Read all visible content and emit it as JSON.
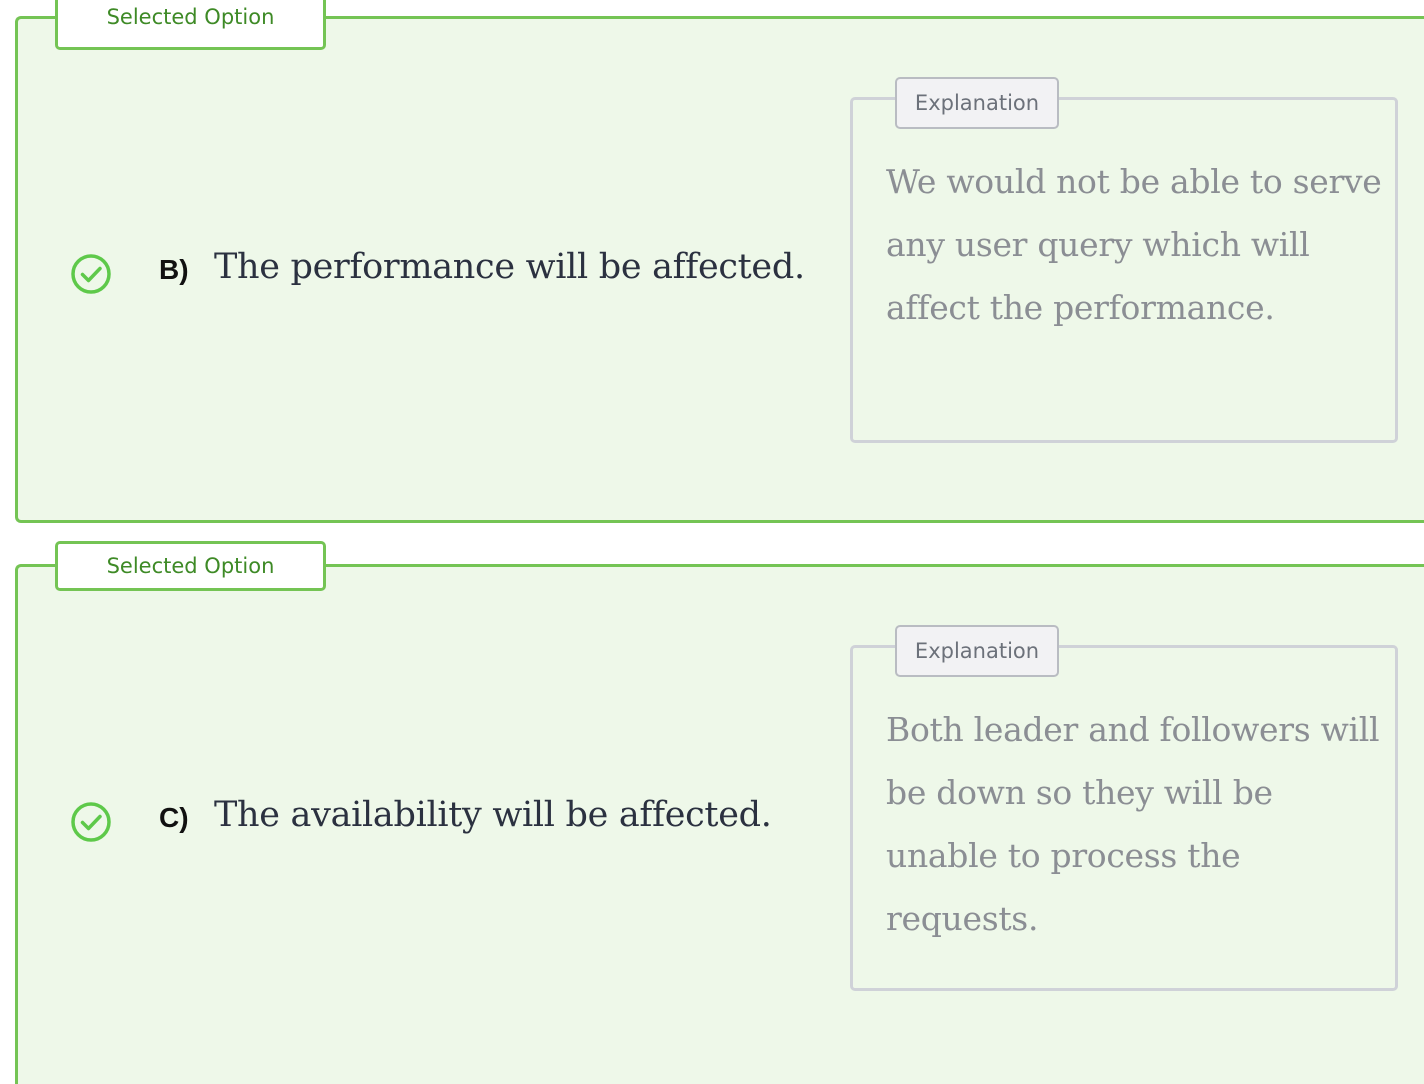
{
  "options": [
    {
      "selected_label": "Selected Option",
      "letter": "B)",
      "text": "The performance will be affected.",
      "explanation_label": "Explanation",
      "explanation": "We would not be able to serve any user query which will affect the performance.",
      "icon": "check-circle-icon"
    },
    {
      "selected_label": "Selected Option",
      "letter": "C)",
      "text": "The availability will be affected.",
      "explanation_label": "Explanation",
      "explanation": "Both leader and followers will be down so they will be unable to process the requests.",
      "icon": "check-circle-icon"
    }
  ],
  "colors": {
    "selected_border": "#74c454",
    "selected_bg": "#eef8e9",
    "selected_label": "#3e8a26",
    "check": "#5ec94a",
    "explanation_border": "#cfd2d8",
    "explanation_text": "#8b8e94"
  }
}
